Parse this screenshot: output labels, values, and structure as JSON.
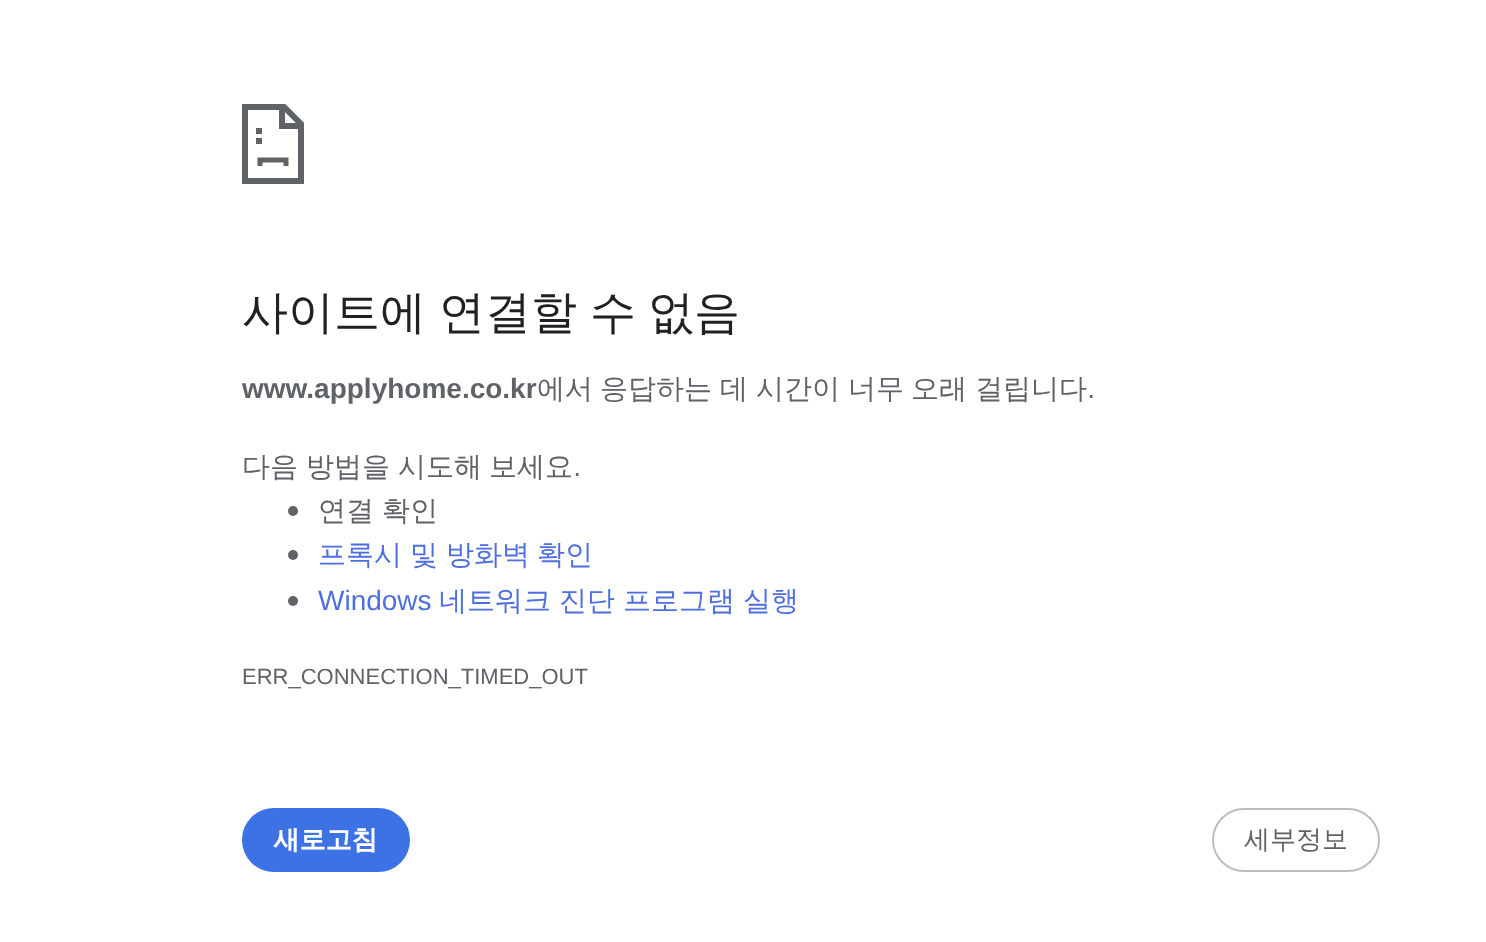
{
  "heading": "사이트에 연결할 수 없음",
  "description": "**www.applyhome.co.kr**에서 응답하는 데 시간이 너무 오래 걸립니다.",
  "suggestions_intro": "다음 방법을 시도해 보세요.",
  "suggestions": [
    {
      "kind": "text",
      "label": "연결 확인"
    },
    {
      "kind": "link",
      "label": "프록시 및 방화벽 확인"
    },
    {
      "kind": "link",
      "label": "Windows 네트워크 진단 프로그램 실행"
    }
  ],
  "error_code": "ERR_CONNECTION_TIMED_OUT",
  "buttons": [
    {
      "kind": "primary",
      "label": "새로고침"
    },
    {
      "kind": "secondary",
      "label": "세부정보"
    }
  ]
}
